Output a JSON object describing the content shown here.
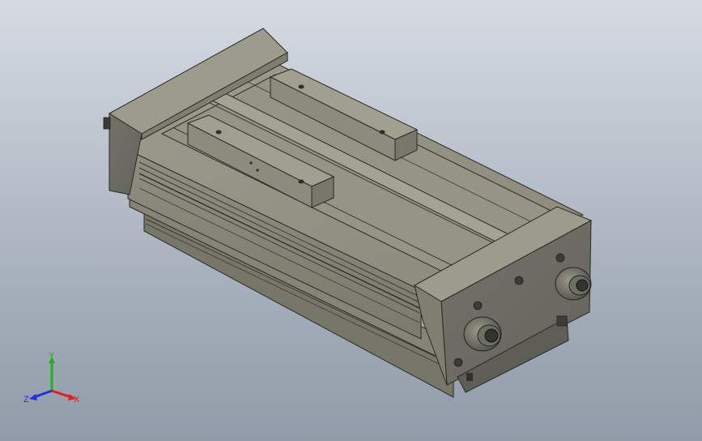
{
  "viewport": {
    "background_top": "#d6dbe3",
    "background_bottom": "#929ca9",
    "model_color": "#8e8d7e"
  },
  "triad": {
    "x_label": "X",
    "y_label": "Y",
    "z_label": "Z",
    "x_color": "#e02020",
    "y_color": "#20b020",
    "z_color": "#2030e0"
  }
}
